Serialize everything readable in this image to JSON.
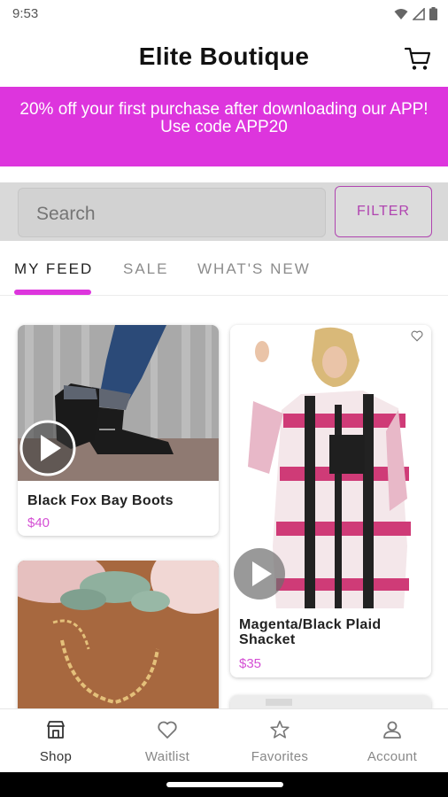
{
  "status_bar": {
    "time": "9:53"
  },
  "header": {
    "title": "Elite Boutique"
  },
  "promo": {
    "line1": "20% off your first purchase after downloading our APP!",
    "line2": "Use code APP20"
  },
  "search": {
    "placeholder": "Search",
    "filter_label": "FILTER"
  },
  "tabs": [
    {
      "label": "MY FEED",
      "active": true
    },
    {
      "label": "SALE",
      "active": false
    },
    {
      "label": "WHAT'S NEW",
      "active": false
    }
  ],
  "products": [
    {
      "name": "Black Fox Bay Boots",
      "price": "$40"
    },
    {
      "name": "Magenta/Black Plaid Shacket",
      "price": "$35"
    }
  ],
  "bottom_nav": [
    {
      "label": "Shop",
      "icon": "shop-icon",
      "active": true
    },
    {
      "label": "Waitlist",
      "icon": "heart-icon",
      "active": false
    },
    {
      "label": "Favorites",
      "icon": "star-icon",
      "active": false
    },
    {
      "label": "Account",
      "icon": "person-icon",
      "active": false
    }
  ],
  "colors": {
    "accent": "#dd35dd",
    "price": "#d44fd4",
    "filter": "#b044b0"
  }
}
